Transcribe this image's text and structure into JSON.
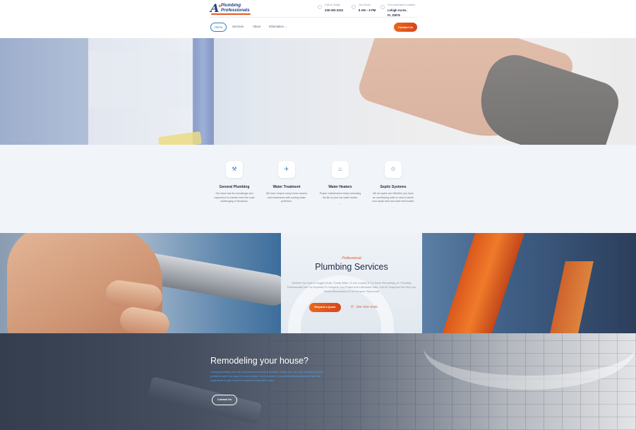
{
  "brand": {
    "logo_mark": "A",
    "logo_plus": "+",
    "logo_line1": "Plumbing",
    "logo_line2": "Professionals"
  },
  "header": {
    "info": [
      {
        "label": "Call us Today",
        "value": "239-303-3333",
        "icon": "phone-icon"
      },
      {
        "label": "Our Hours",
        "value": "8 AM – 6 PM",
        "icon": "clock-icon"
      },
      {
        "label": "Our convenient Location",
        "value": "Lehigh Acres, FL 33976",
        "icon": "location-icon"
      }
    ]
  },
  "nav": {
    "items": [
      {
        "label": "Home",
        "active": true
      },
      {
        "label": "Services"
      },
      {
        "label": "About"
      },
      {
        "label": "Information",
        "has_dropdown": true
      }
    ],
    "dropdown_glyph": "⌄",
    "contact_label": "Contact Us"
  },
  "services": [
    {
      "icon": "faucet-icon",
      "glyph": "⚒",
      "title": "General Plumbing",
      "desc": "Our team has the knowledge and experience to handle even the most challenging of situations.",
      "more": "...."
    },
    {
      "icon": "spray-icon",
      "glyph": "✈",
      "title": "Water Treatment",
      "desc": "We have helped many home owners and businesses with solving water problems.",
      "more": "...."
    },
    {
      "icon": "water-heater-icon",
      "glyph": "♨",
      "title": "Water Heaters",
      "desc": "Proper maintenance helps extending the life of your hot water heater.",
      "more": "...."
    },
    {
      "icon": "septic-icon",
      "glyph": "♲",
      "title": "Septic Systems",
      "desc": "We do septic too! Whether you have an overflowing toilet or need a whole new septic tank and drain field install.",
      "more": "...."
    }
  ],
  "plumbing": {
    "kicker": "Professional",
    "title": "Plumbing Services",
    "desc": "Whether You Have A Clogged Drain, Smelly Water, Or Are Looking To Do Some Remodeling, A+ Plumbing Professionals Has The Expertise To Complete Your Project At An Affordable Rate. Call Us Today And See Why Our Clients Recommend Us To Everyone They Know!",
    "quote_label": "Request a Quote",
    "phone_icon": "✆",
    "phone": "239–303–3333"
  },
  "remodel": {
    "title": "Remodeling your house?",
    "desc": "Having plumbing done by a licensed and insured plumber means you can rest assured that any problems aren't an issue for your project. Don't chance it, our professional plumbers have the experience to get it done to current construction code.",
    "button_label": "Contact Us"
  },
  "colors": {
    "accent_orange": "#e05a22",
    "brand_blue": "#1e3d80",
    "link_blue": "#2f7fc1",
    "section_bg": "#f1f4f8"
  }
}
